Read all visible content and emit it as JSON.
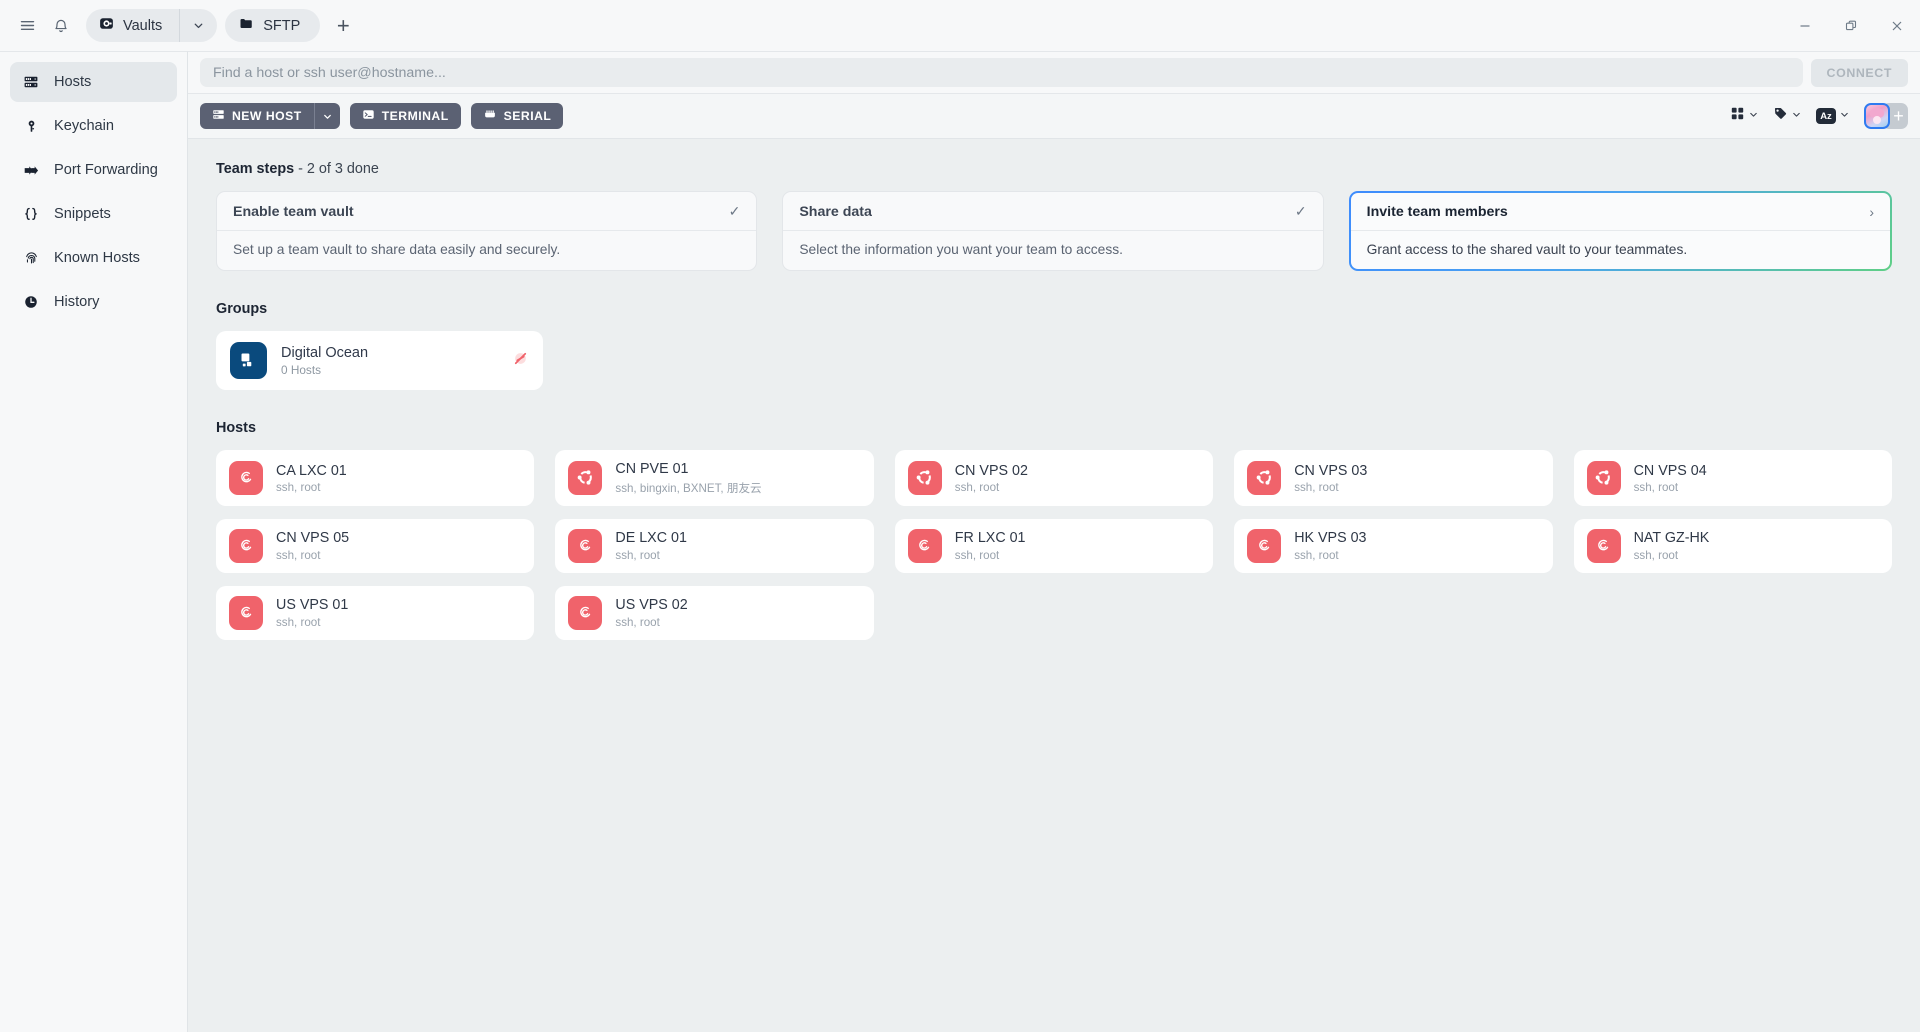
{
  "titlebar": {
    "menu_icon": "hamburger-menu-icon",
    "bell_icon": "notification-bell-icon",
    "tab_vaults_label": "Vaults",
    "tab_sftp_label": "SFTP",
    "new_tab_label": "+",
    "minimize_label": "─",
    "maximize_label": "❐",
    "close_label": "✕"
  },
  "sidebar": {
    "items": [
      {
        "label": "Hosts",
        "icon": "server-rack-icon",
        "active": true
      },
      {
        "label": "Keychain",
        "icon": "key-icon",
        "active": false
      },
      {
        "label": "Port Forwarding",
        "icon": "arrows-right-icon",
        "active": false
      },
      {
        "label": "Snippets",
        "icon": "code-braces-icon",
        "active": false
      },
      {
        "label": "Known Hosts",
        "icon": "fingerprint-icon",
        "active": false
      },
      {
        "label": "History",
        "icon": "clock-icon",
        "active": false
      }
    ]
  },
  "search": {
    "placeholder": "Find a host or ssh user@hostname...",
    "value": "",
    "connect_label": "CONNECT"
  },
  "toolbar": {
    "new_host_label": "NEW HOST",
    "new_host_icon": "server-rack-icon",
    "new_host_caret": "chevron-down-icon",
    "terminal_label": "TERMINAL",
    "terminal_icon": "terminal-icon",
    "serial_label": "SERIAL",
    "serial_icon": "serial-port-icon",
    "grid_view_icon": "grid-view-icon",
    "tag_filter_icon": "tag-icon",
    "sort_label": "Az",
    "sort_icon": "sort-alpha-icon",
    "avatar_name": "user-avatar",
    "add_user_label": "+"
  },
  "team_steps": {
    "title": "Team steps",
    "progress": " - 2 of 3 done",
    "cards": [
      {
        "title": "Enable team vault",
        "description": "Set up a team vault to share data easily and securely.",
        "mark": "✓",
        "mark_name": "check-icon",
        "highlight": false
      },
      {
        "title": "Share data",
        "description": "Select the information you want your team to access.",
        "mark": "✓",
        "mark_name": "check-icon",
        "highlight": false
      },
      {
        "title": "Invite team members",
        "description": "Grant access to the shared vault to your teammates.",
        "mark": "›",
        "mark_name": "chevron-right-icon",
        "highlight": true
      }
    ]
  },
  "groups": {
    "title": "Groups",
    "items": [
      {
        "name": "Digital Ocean",
        "sub": "0 Hosts",
        "icon": "digital-ocean-logo-icon",
        "badge": "shared-off-icon"
      }
    ]
  },
  "hosts": {
    "title": "Hosts",
    "items": [
      {
        "name": "CA LXC 01",
        "sub": "ssh, root",
        "os": "debian"
      },
      {
        "name": "CN PVE 01",
        "sub": "ssh, bingxin, BXNET, 朋友云",
        "os": "ubuntu"
      },
      {
        "name": "CN VPS 02",
        "sub": "ssh, root",
        "os": "ubuntu"
      },
      {
        "name": "CN VPS 03",
        "sub": "ssh, root",
        "os": "ubuntu"
      },
      {
        "name": "CN VPS 04",
        "sub": "ssh, root",
        "os": "ubuntu"
      },
      {
        "name": "CN VPS 05",
        "sub": "ssh, root",
        "os": "debian"
      },
      {
        "name": "DE LXC 01",
        "sub": "ssh, root",
        "os": "debian"
      },
      {
        "name": "FR LXC 01",
        "sub": "ssh, root",
        "os": "debian"
      },
      {
        "name": "HK VPS 03",
        "sub": "ssh, root",
        "os": "debian"
      },
      {
        "name": "NAT GZ-HK",
        "sub": "ssh, root",
        "os": "debian"
      },
      {
        "name": "US VPS 01",
        "sub": "ssh, root",
        "os": "debian"
      },
      {
        "name": "US VPS 02",
        "sub": "ssh, root",
        "os": "debian"
      }
    ]
  },
  "colors": {
    "accent_blue": "#2f7bf0",
    "accent_green": "#5fcf86",
    "host_icon_red": "#f0636b",
    "digital_ocean_blue": "#0a4a7d",
    "button_dark": "#5b6173",
    "content_bg": "#eceff0",
    "sidebar_bg": "#f7f8f9"
  }
}
